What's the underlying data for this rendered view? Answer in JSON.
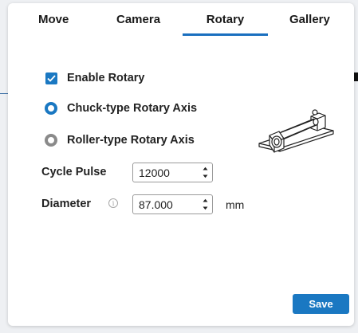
{
  "tabs": [
    {
      "label": "Move",
      "active": false
    },
    {
      "label": "Camera",
      "active": false
    },
    {
      "label": "Rotary",
      "active": true
    },
    {
      "label": "Gallery",
      "active": false
    }
  ],
  "enable_rotary": {
    "label": "Enable Rotary",
    "checked": true
  },
  "axis_options": [
    {
      "label": "Chuck-type Rotary Axis",
      "selected": true
    },
    {
      "label": "Roller-type Rotary Axis",
      "selected": false
    }
  ],
  "cycle_pulse": {
    "label": "Cycle Pulse",
    "value": "12000"
  },
  "diameter": {
    "label": "Diameter",
    "value": "87.000",
    "unit": "mm",
    "info_icon": "info-icon"
  },
  "save_label": "Save",
  "colors": {
    "accent": "#1a78c2",
    "radio_off": "#8a8a8a"
  }
}
